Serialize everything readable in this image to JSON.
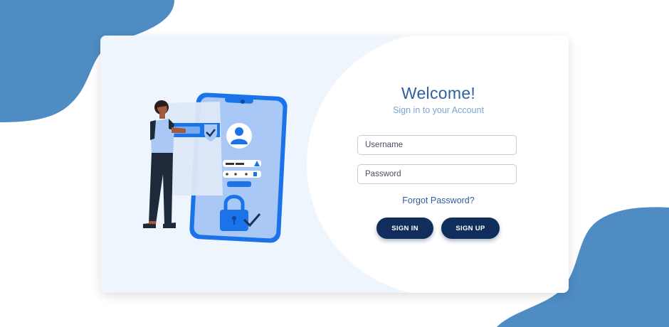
{
  "login": {
    "title": "Welcome!",
    "subtitle": "Sign in to your Account",
    "username_placeholder": "Username",
    "password_placeholder": "Password",
    "forgot_label": "Forgot Password?",
    "signin_label": "SIGN IN",
    "signup_label": "SIGN UP"
  },
  "colors": {
    "brand_dark": "#112d5c",
    "blob_blue": "#4f8cc4",
    "title_blue": "#2f5fa0",
    "panel_bg": "#eef5fd"
  },
  "icons": [
    "lock-icon",
    "user-icon",
    "checkmark-icon",
    "shield-icon"
  ]
}
